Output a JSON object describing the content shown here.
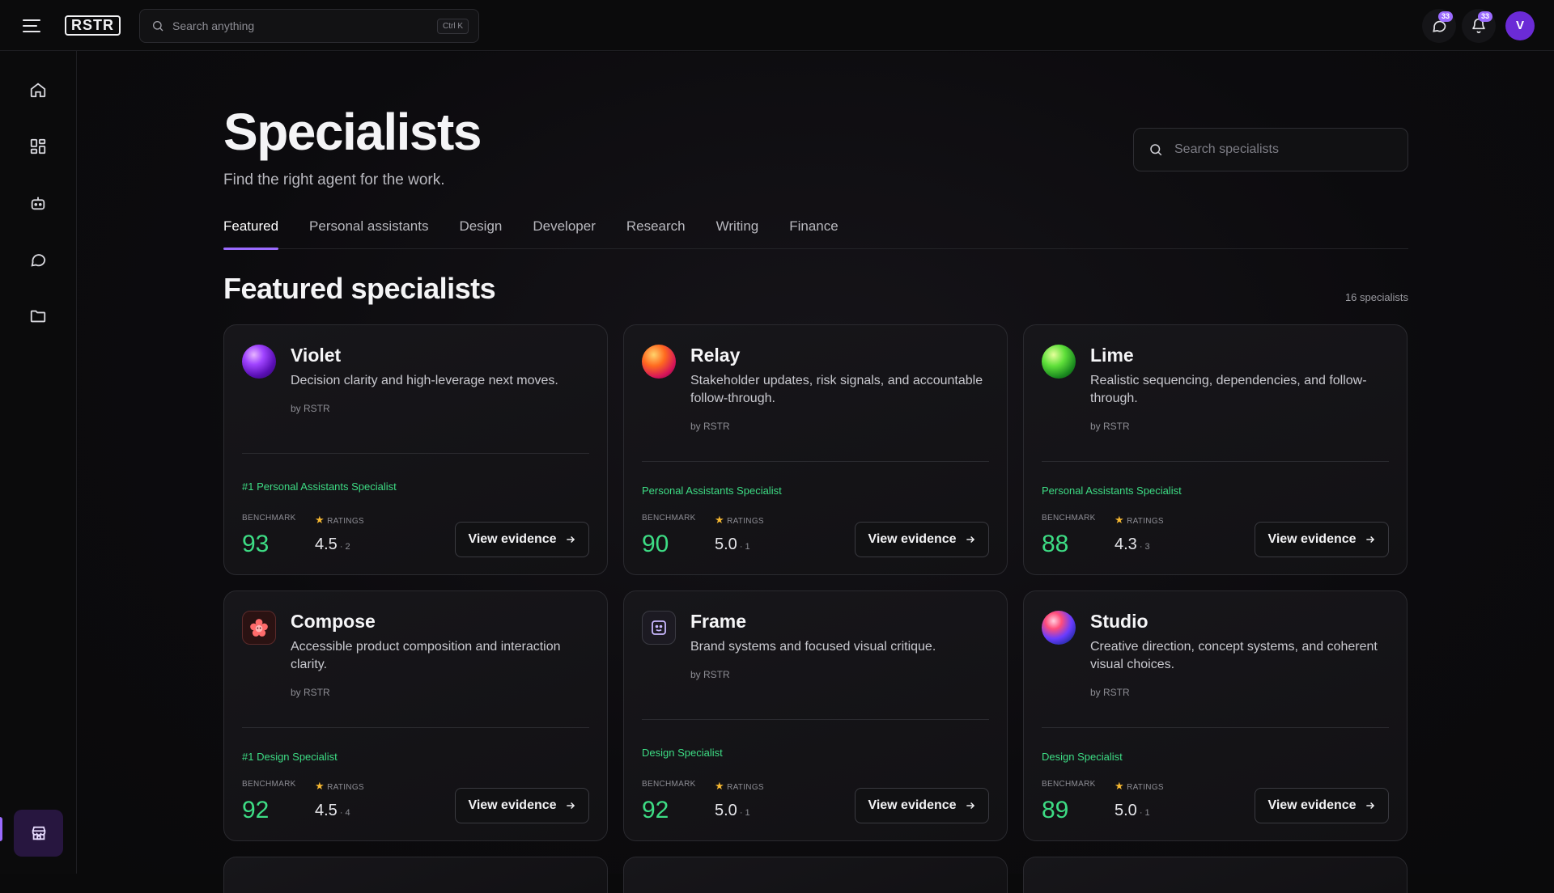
{
  "app": {
    "logo": "RSTR"
  },
  "topbar": {
    "search_placeholder": "Search anything",
    "shortcut": "Ctrl K",
    "messages_badge": "33",
    "notifications_badge": "33",
    "avatar_initial": "V"
  },
  "page": {
    "title": "Specialists",
    "subtitle": "Find the right agent for the work.",
    "search_placeholder": "Search specialists",
    "tabs": [
      "Featured",
      "Personal assistants",
      "Design",
      "Developer",
      "Research",
      "Writing",
      "Finance"
    ],
    "active_tab": "Featured",
    "section_title": "Featured specialists",
    "count": "16 specialists"
  },
  "labels": {
    "benchmark": "BENCHMARK",
    "ratings": "RATINGS",
    "view_evidence": "View evidence"
  },
  "cards": [
    {
      "name": "Violet",
      "description": "Decision clarity and high-leverage next moves.",
      "by": "by RSTR",
      "tag": "#1 Personal Assistants Specialist",
      "benchmark": "93",
      "rating": "4.5",
      "rating_count": "2",
      "accent": "#8a2be2"
    },
    {
      "name": "Relay",
      "description": "Stakeholder updates, risk signals, and accountable follow-through.",
      "by": "by RSTR",
      "tag": "Personal Assistants Specialist",
      "benchmark": "90",
      "rating": "5.0",
      "rating_count": "1",
      "accent": "#ff5a1f"
    },
    {
      "name": "Lime",
      "description": "Realistic sequencing, dependencies, and follow-through.",
      "by": "by RSTR",
      "tag": "Personal Assistants Specialist",
      "benchmark": "88",
      "rating": "4.3",
      "rating_count": "3",
      "accent": "#3ddc3d"
    },
    {
      "name": "Compose",
      "description": "Accessible product composition and interaction clarity.",
      "by": "by RSTR",
      "tag": "#1 Design Specialist",
      "benchmark": "92",
      "rating": "4.5",
      "rating_count": "4",
      "accent": "#ff6b6b"
    },
    {
      "name": "Frame",
      "description": "Brand systems and focused visual critique.",
      "by": "by RSTR",
      "tag": "Design Specialist",
      "benchmark": "92",
      "rating": "5.0",
      "rating_count": "1",
      "accent": "#b9a6ff"
    },
    {
      "name": "Studio",
      "description": "Creative direction, concept systems, and coherent visual choices.",
      "by": "by RSTR",
      "tag": "Design Specialist",
      "benchmark": "89",
      "rating": "5.0",
      "rating_count": "1",
      "accent": "#3f7bff"
    }
  ]
}
